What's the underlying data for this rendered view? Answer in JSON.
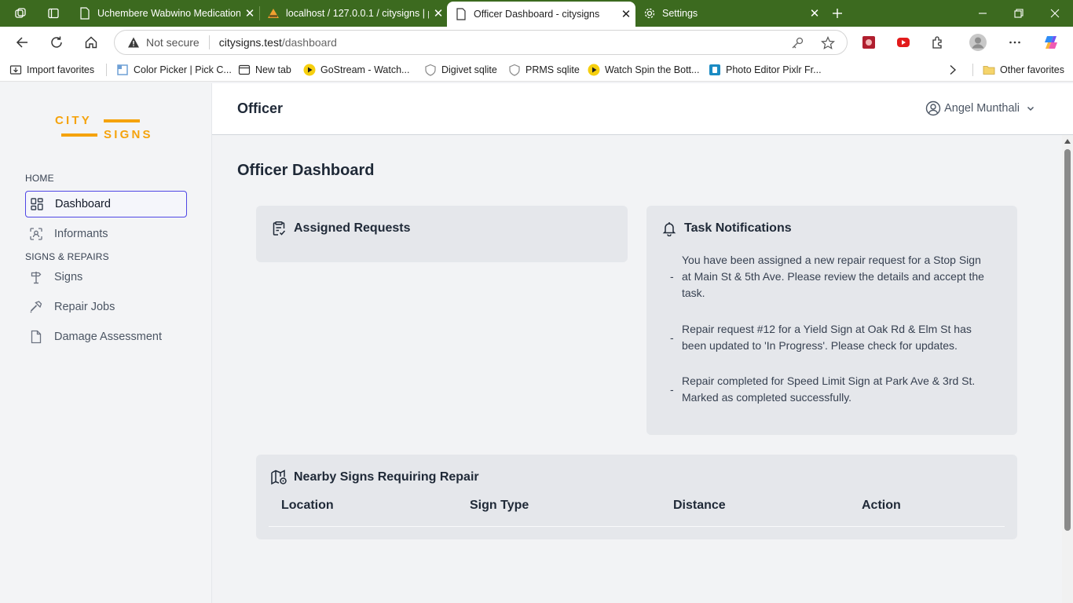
{
  "browser": {
    "tabs": [
      {
        "title": "Uchembere Wabwino Medication",
        "active": false
      },
      {
        "title": "localhost / 127.0.0.1 / citysigns | p",
        "active": false
      },
      {
        "title": "Officer Dashboard - citysigns",
        "active": true
      },
      {
        "title": "Settings",
        "active": false
      }
    ],
    "address": {
      "security_label": "Not secure",
      "host": "citysigns.test",
      "path": "/dashboard"
    },
    "favorites": [
      {
        "label": "Import favorites",
        "icon": "import-icon"
      },
      {
        "label": "Color Picker | Pick C...",
        "icon": "color-picker-icon"
      },
      {
        "label": "New tab",
        "icon": "new-tab-icon"
      },
      {
        "label": "GoStream - Watch...",
        "icon": "play-icon"
      },
      {
        "label": "Digivet sqlite",
        "icon": "shield-icon"
      },
      {
        "label": "PRMS sqlite",
        "icon": "shield-icon"
      },
      {
        "label": "Watch Spin the Bott...",
        "icon": "play-icon"
      },
      {
        "label": "Photo Editor Pixlr Fr...",
        "icon": "pixlr-icon"
      },
      {
        "label": "Other favorites",
        "icon": "folder-icon"
      }
    ]
  },
  "app": {
    "logo": {
      "line1": "CITY",
      "line2": "SIGNS",
      "color": "#f5a30c"
    },
    "sidebar": {
      "sections": [
        {
          "heading": "HOME",
          "items": [
            {
              "label": "Dashboard",
              "icon": "grid-icon",
              "active": true
            },
            {
              "label": "Informants",
              "icon": "scan-user-icon",
              "active": false
            }
          ]
        },
        {
          "heading": "SIGNS & REPAIRS",
          "items": [
            {
              "label": "Signs",
              "icon": "signpost-icon",
              "active": false
            },
            {
              "label": "Repair Jobs",
              "icon": "hammer-icon",
              "active": false
            },
            {
              "label": "Damage Assessment",
              "icon": "document-icon",
              "active": false
            }
          ]
        }
      ]
    },
    "header": {
      "title": "Officer",
      "user_name": "Angel Munthali"
    },
    "page_title": "Officer Dashboard",
    "assigned_requests": {
      "title": "Assigned Requests",
      "icon": "clipboard-check-icon"
    },
    "task_notifications": {
      "title": "Task Notifications",
      "icon": "bell-icon",
      "bullet": "-",
      "items": [
        "You have been assigned a new repair request for a Stop Sign at Main St & 5th Ave. Please review the details and accept the task.",
        "Repair request #12 for a Yield Sign at Oak Rd & Elm St has been updated to 'In Progress'. Please check for updates.",
        "Repair completed for Speed Limit Sign at Park Ave & 3rd St. Marked as completed successfully."
      ]
    },
    "nearby_signs": {
      "title": "Nearby Signs Requiring Repair",
      "icon": "map-icon",
      "columns": [
        "Location",
        "Sign Type",
        "Distance",
        "Action"
      ],
      "rows": []
    }
  }
}
